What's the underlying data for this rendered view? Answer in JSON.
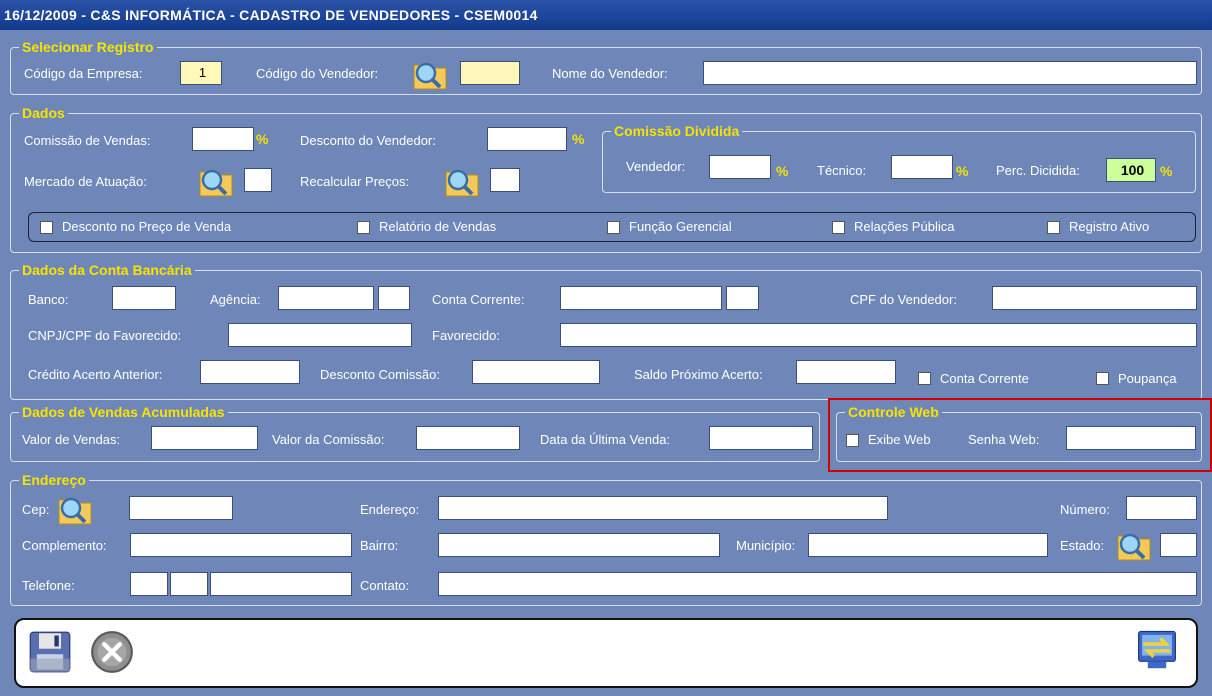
{
  "window": {
    "title": "16/12/2009 - C&S INFORMÁTICA - CADASTRO DE VENDEDORES - CSEM0014"
  },
  "selecionar": {
    "legend": "Selecionar Registro",
    "cod_empresa_label": "Código da Empresa:",
    "cod_empresa_value": "1",
    "cod_vendedor_label": "Código do Vendedor:",
    "cod_vendedor_value": "",
    "nome_vendedor_label": "Nome do Vendedor:",
    "nome_vendedor_value": ""
  },
  "dados": {
    "legend": "Dados",
    "comissao_label": "Comissão de Vendas:",
    "desconto_label": "Desconto  do Vendedor:",
    "mercado_label": "Mercado de  Atuação:",
    "recalcular_label": "Recalcular Preços:",
    "pct": "%",
    "checks": [
      "Desconto no Preço de Venda",
      "Relatório de Vendas",
      "Função Gerencial",
      "Relações Pública",
      "Registro Ativo"
    ]
  },
  "comissao_dividida": {
    "legend": "Comissão Dividida",
    "vendedor_label": "Vendedor:",
    "tecnico_label": "Técnico:",
    "perc_label": "Perc. Dicidida:",
    "perc_value": "100"
  },
  "conta": {
    "legend": "Dados da Conta Bancária",
    "banco_label": "Banco:",
    "agencia_label": "Agência:",
    "conta_label": "Conta Corrente:",
    "cpf_label": "CPF do Vendedor:",
    "cnpj_label": "CNPJ/CPF do Favorecido:",
    "favorecido_label": "Favorecido:",
    "credito_label": "Crédito Acerto Anterior:",
    "desconto_comissao_label": "Desconto Comissão:",
    "saldo_label": "Saldo Próximo Acerto:",
    "chk_conta_corrente": "Conta Corrente",
    "chk_poupanca": "Poupança"
  },
  "vendas": {
    "legend": "Dados de Vendas Acumuladas",
    "valor_vendas_label": "Valor de Vendas:",
    "valor_comissao_label": "Valor da Comissão:",
    "data_ultima_label": "Data da Última Venda:"
  },
  "web": {
    "legend": "Controle Web",
    "exibe_label": "Exibe Web",
    "senha_label": "Senha Web:"
  },
  "endereco": {
    "legend": "Endereço",
    "cep_label": "Cep:",
    "endereco_label": "Endereço:",
    "numero_label": "Número:",
    "complemento_label": "Complemento:",
    "bairro_label": "Bairro:",
    "municipio_label": "Município:",
    "estado_label": "Estado:",
    "telefone_label": "Telefone:",
    "contato_label": "Contato:"
  },
  "colors": {
    "window_bg": "#6e87b8",
    "legend": "#f7e300",
    "title_bar": "#123a8c",
    "highlight": "#d10000"
  },
  "toolbar": {
    "icons": [
      "save-disk-icon",
      "cancel-x-icon",
      "exit-swap-icon"
    ]
  }
}
